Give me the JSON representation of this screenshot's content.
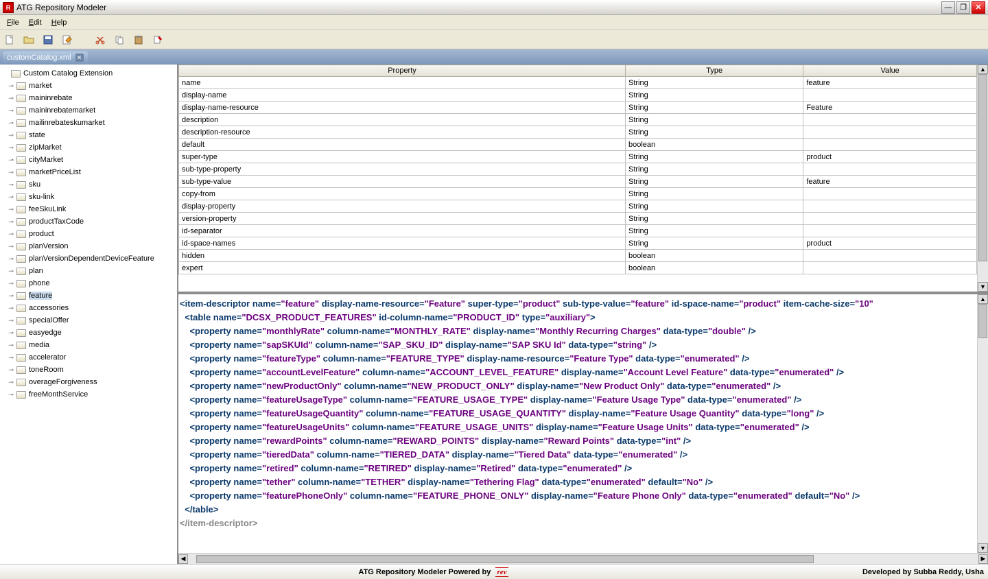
{
  "title": "ATG Repository Modeler",
  "menus": [
    "File",
    "Edit",
    "Help"
  ],
  "tab_name": "customCatalog.xml",
  "tree_root": "Custom Catalog Extension",
  "tree_children": [
    "market",
    "maininrebate",
    "maininrebatemarket",
    "mailinrebateskumarket",
    "state",
    "zipMarket",
    "cityMarket",
    "marketPriceList",
    "sku",
    "sku-link",
    "feeSkuLink",
    "productTaxCode",
    "product",
    "planVersion",
    "planVersionDependentDeviceFeature",
    "plan",
    "phone",
    "feature",
    "accessories",
    "specialOffer",
    "easyedge",
    "media",
    "accelerator",
    "toneRoom",
    "overageForgiveness",
    "freeMonthService"
  ],
  "selected_tree_index": 17,
  "table_headers": [
    "Property",
    "Type",
    "Value"
  ],
  "table_rows": [
    {
      "p": "name",
      "t": "String",
      "v": "feature"
    },
    {
      "p": "display-name",
      "t": "String",
      "v": ""
    },
    {
      "p": "display-name-resource",
      "t": "String",
      "v": "Feature"
    },
    {
      "p": "description",
      "t": "String",
      "v": ""
    },
    {
      "p": "description-resource",
      "t": "String",
      "v": ""
    },
    {
      "p": "default",
      "t": "boolean",
      "v": ""
    },
    {
      "p": "super-type",
      "t": "String",
      "v": "product"
    },
    {
      "p": "sub-type-property",
      "t": "String",
      "v": ""
    },
    {
      "p": "sub-type-value",
      "t": "String",
      "v": "feature"
    },
    {
      "p": "copy-from",
      "t": "String",
      "v": ""
    },
    {
      "p": "display-property",
      "t": "String",
      "v": ""
    },
    {
      "p": "version-property",
      "t": "String",
      "v": ""
    },
    {
      "p": "id-separator",
      "t": "String",
      "v": ""
    },
    {
      "p": "id-space-names",
      "t": "String",
      "v": "product"
    },
    {
      "p": "hidden",
      "t": "boolean",
      "v": ""
    },
    {
      "p": "expert",
      "t": "boolean",
      "v": ""
    }
  ],
  "xml": {
    "descriptor_attrs": [
      {
        "n": "name",
        "v": "feature"
      },
      {
        "n": "display-name-resource",
        "v": "Feature"
      },
      {
        "n": "super-type",
        "v": "product"
      },
      {
        "n": "sub-type-value",
        "v": "feature"
      },
      {
        "n": "id-space-name",
        "v": "product"
      },
      {
        "n": "item-cache-size",
        "v": "10"
      }
    ],
    "table_attrs": [
      {
        "n": "name",
        "v": "DCSX_PRODUCT_FEATURES"
      },
      {
        "n": "id-column-name",
        "v": "PRODUCT_ID"
      },
      {
        "n": "type",
        "v": "auxiliary"
      }
    ],
    "props": [
      [
        {
          "n": "name",
          "v": "monthlyRate"
        },
        {
          "n": "column-name",
          "v": "MONTHLY_RATE"
        },
        {
          "n": "display-name",
          "v": "Monthly Recurring Charges"
        },
        {
          "n": "data-type",
          "v": "double"
        }
      ],
      [
        {
          "n": "name",
          "v": "sapSKUId"
        },
        {
          "n": "column-name",
          "v": "SAP_SKU_ID"
        },
        {
          "n": "display-name",
          "v": "SAP SKU Id"
        },
        {
          "n": "data-type",
          "v": "string"
        }
      ],
      [
        {
          "n": "name",
          "v": "featureType"
        },
        {
          "n": "column-name",
          "v": "FEATURE_TYPE"
        },
        {
          "n": "display-name-resource",
          "v": "Feature Type"
        },
        {
          "n": "data-type",
          "v": "enumerated"
        }
      ],
      [
        {
          "n": "name",
          "v": "accountLevelFeature"
        },
        {
          "n": "column-name",
          "v": "ACCOUNT_LEVEL_FEATURE"
        },
        {
          "n": "display-name",
          "v": "Account Level Feature"
        },
        {
          "n": "data-type",
          "v": "enumerated"
        }
      ],
      [
        {
          "n": "name",
          "v": "newProductOnly"
        },
        {
          "n": "column-name",
          "v": "NEW_PRODUCT_ONLY"
        },
        {
          "n": "display-name",
          "v": "New Product Only"
        },
        {
          "n": "data-type",
          "v": "enumerated"
        }
      ],
      [
        {
          "n": "name",
          "v": "featureUsageType"
        },
        {
          "n": "column-name",
          "v": "FEATURE_USAGE_TYPE"
        },
        {
          "n": "display-name",
          "v": "Feature Usage Type"
        },
        {
          "n": "data-type",
          "v": "enumerated"
        }
      ],
      [
        {
          "n": "name",
          "v": "featureUsageQuantity"
        },
        {
          "n": "column-name",
          "v": "FEATURE_USAGE_QUANTITY"
        },
        {
          "n": "display-name",
          "v": "Feature Usage Quantity"
        },
        {
          "n": "data-type",
          "v": "long"
        }
      ],
      [
        {
          "n": "name",
          "v": "featureUsageUnits"
        },
        {
          "n": "column-name",
          "v": "FEATURE_USAGE_UNITS"
        },
        {
          "n": "display-name",
          "v": "Feature Usage Units"
        },
        {
          "n": "data-type",
          "v": "enumerated"
        }
      ],
      [
        {
          "n": "name",
          "v": "rewardPoints"
        },
        {
          "n": "column-name",
          "v": "REWARD_POINTS"
        },
        {
          "n": "display-name",
          "v": "Reward Points"
        },
        {
          "n": "data-type",
          "v": "int"
        }
      ],
      [
        {
          "n": "name",
          "v": "tieredData"
        },
        {
          "n": "column-name",
          "v": "TIERED_DATA"
        },
        {
          "n": "display-name",
          "v": "Tiered Data"
        },
        {
          "n": "data-type",
          "v": "enumerated"
        }
      ],
      [
        {
          "n": "name",
          "v": "retired"
        },
        {
          "n": "column-name",
          "v": "RETIRED"
        },
        {
          "n": "display-name",
          "v": "Retired"
        },
        {
          "n": "data-type",
          "v": "enumerated"
        }
      ],
      [
        {
          "n": "name",
          "v": "tether"
        },
        {
          "n": "column-name",
          "v": "TETHER"
        },
        {
          "n": "display-name",
          "v": "Tethering Flag"
        },
        {
          "n": "data-type",
          "v": "enumerated"
        },
        {
          "n": "default",
          "v": "No"
        }
      ],
      [
        {
          "n": "name",
          "v": "featurePhoneOnly"
        },
        {
          "n": "column-name",
          "v": "FEATURE_PHONE_ONLY"
        },
        {
          "n": "display-name",
          "v": "Feature Phone Only"
        },
        {
          "n": "data-type",
          "v": "enumerated"
        },
        {
          "n": "default",
          "v": "No"
        }
      ]
    ]
  },
  "status_center": "ATG Repository Modeler Powered by",
  "status_right": "Developed by Subba Reddy, Usha"
}
